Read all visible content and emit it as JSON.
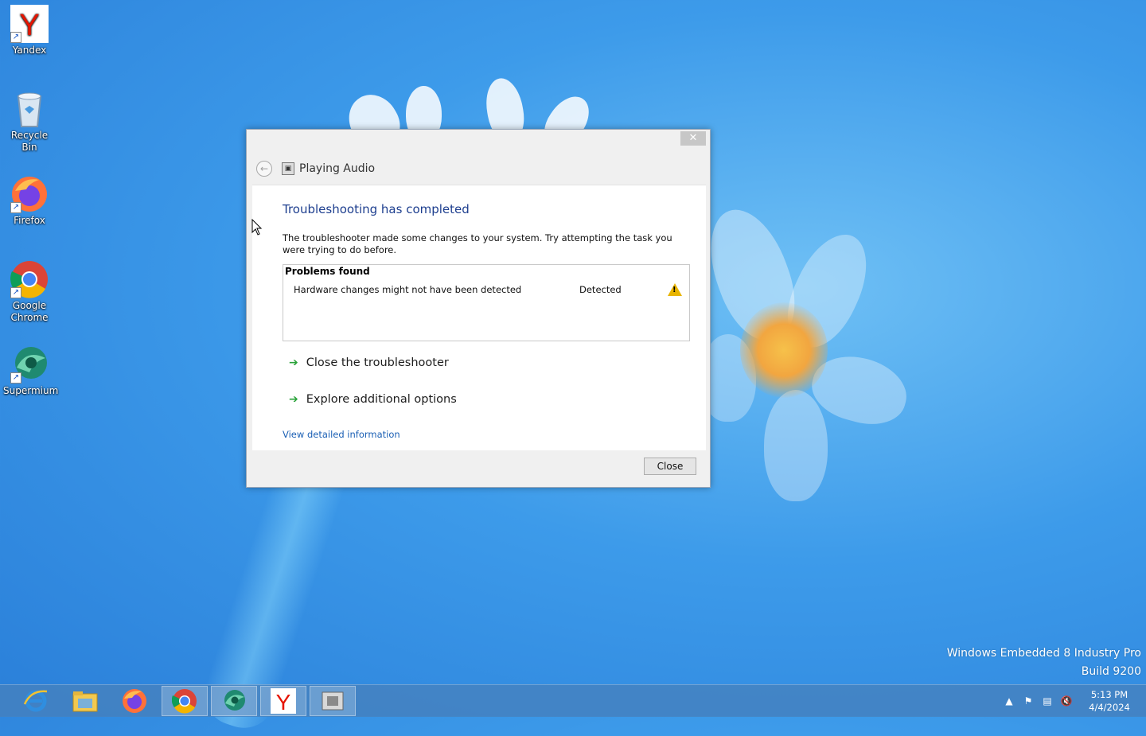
{
  "desktop": {
    "icons": [
      {
        "label": "Yandex"
      },
      {
        "label": "Recycle Bin"
      },
      {
        "label": "Firefox"
      },
      {
        "label": "Google Chrome"
      },
      {
        "label": "Supermium"
      }
    ],
    "watermark": {
      "line1": "Windows Embedded 8 Industry Pro",
      "line2": "Build 9200"
    }
  },
  "dialog": {
    "close_glyph": "✕",
    "nav_title": "Playing Audio",
    "heading": "Troubleshooting has completed",
    "description": "The troubleshooter made some changes to your system. Try attempting the task you were trying to do before.",
    "problems": {
      "title": "Problems found",
      "rows": [
        {
          "name": "Hardware changes might not have been detected",
          "status": "Detected",
          "icon": "warning-icon"
        }
      ]
    },
    "actions": [
      {
        "label": "Close the troubleshooter"
      },
      {
        "label": "Explore additional options"
      }
    ],
    "detail_link": "View detailed information",
    "close_button": "Close"
  },
  "taskbar": {
    "buttons": [
      "internet-explorer",
      "file-explorer",
      "firefox",
      "chrome",
      "supermium",
      "yandex",
      "troubleshooter"
    ],
    "clock": {
      "time": "5:13 PM",
      "date": "4/4/2024"
    }
  },
  "colors": {
    "heading": "#1e3f8f",
    "link": "#1a5fb4",
    "arrow": "#2aa33a",
    "warning": "#e8b400"
  }
}
